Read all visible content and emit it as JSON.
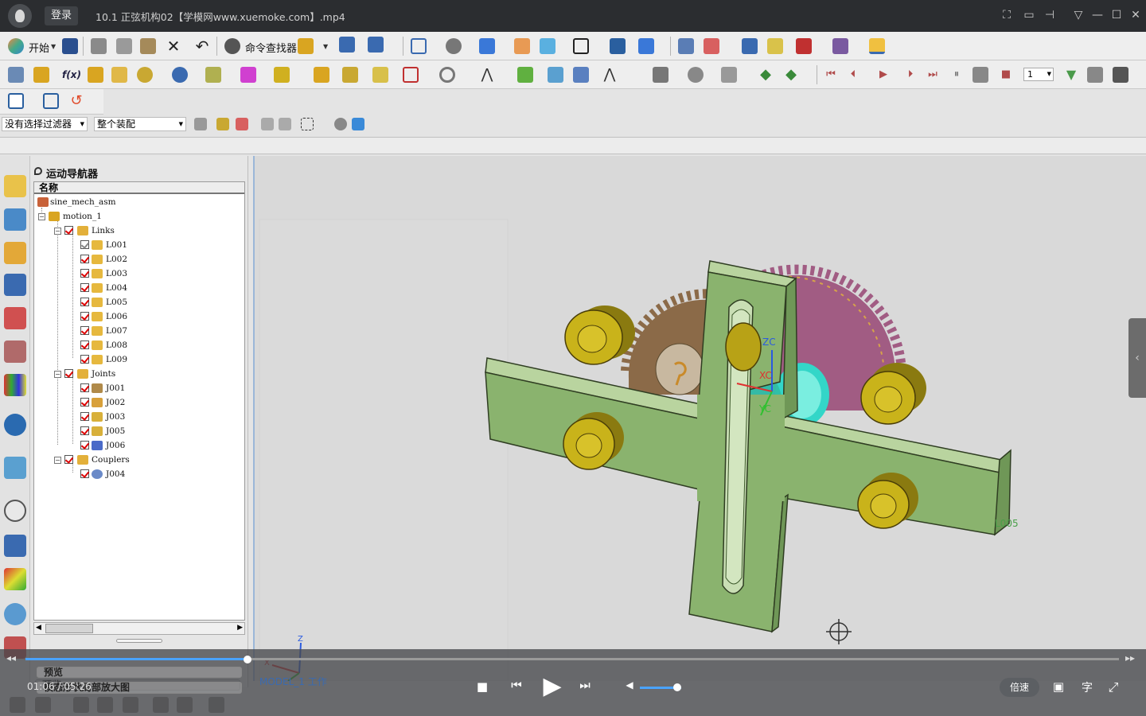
{
  "player": {
    "login_label": "登录",
    "video_title": "10.1  正弦机构02【学模网www.xuemoke.com】.mp4",
    "time_display": "01:06 / 05:26",
    "speed_label": "倍速",
    "subtitle_label": "字",
    "progress_fraction": 0.203,
    "volume_fraction": 0.9
  },
  "toolbar": {
    "start_label": "开始",
    "cmd_finder_label": "命令查找器",
    "frame_counter_value": "1"
  },
  "selection_bar": {
    "filter_value": "没有选择过滤器",
    "scope_value": "整个装配"
  },
  "navigator": {
    "title": "运动导航器",
    "column_header": "名称",
    "root": "sine_mech_asm",
    "motion": "motion_1",
    "groups": [
      {
        "label": "Links",
        "items": [
          "L001",
          "L002",
          "L003",
          "L004",
          "L005",
          "L006",
          "L007",
          "L008",
          "L009"
        ]
      },
      {
        "label": "Joints",
        "items": [
          "J001",
          "J002",
          "J003",
          "J005",
          "J006"
        ]
      },
      {
        "label": "Couplers",
        "items": [
          "J004"
        ]
      }
    ],
    "preview_label": "预览",
    "undocked_label": "模态形状局部放大图"
  },
  "viewport": {
    "model_tab": "MODEL_1 工作",
    "link_label": "L005",
    "csys_labels": {
      "zc": "ZC",
      "xc": "XC",
      "yc": "YC"
    },
    "triad_labels": {
      "z": "Z",
      "x": "X"
    },
    "colors": {
      "plate": "#8ab36e",
      "plate_edge": "#2f3d22",
      "gear_left": "#8b6a48",
      "gear_right": "#a15c83",
      "roller": "#c9b31a",
      "hub": "#33d6c8",
      "slot": "#b9d49f"
    }
  }
}
